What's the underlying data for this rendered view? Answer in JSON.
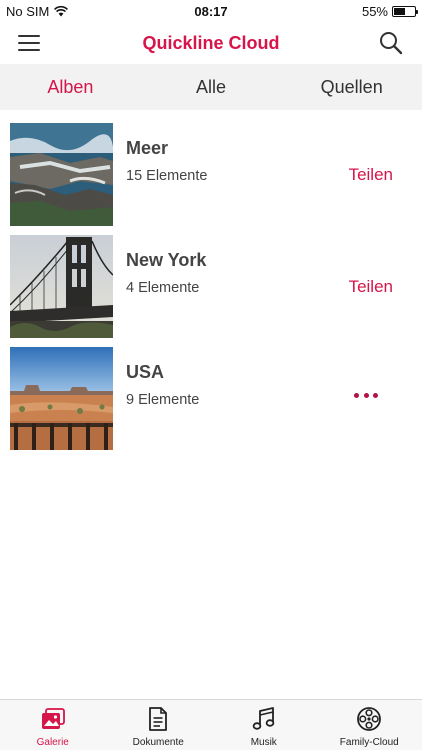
{
  "status_bar": {
    "carrier": "No SIM",
    "time": "08:17",
    "battery": "55%",
    "battery_level": 0.55
  },
  "header": {
    "title": "Quickline Cloud",
    "menu_icon": "menu-icon",
    "search_icon": "search-icon"
  },
  "tabs": [
    {
      "label": "Alben",
      "active": true
    },
    {
      "label": "Alle",
      "active": false
    },
    {
      "label": "Quellen",
      "active": false
    }
  ],
  "albums": [
    {
      "name": "Meer",
      "count": "15 Elemente",
      "action": "Teilen"
    },
    {
      "name": "New York",
      "count": "4 Elemente",
      "action": "Teilen"
    },
    {
      "name": "USA",
      "count": "9 Elemente",
      "action": "more-icon"
    }
  ],
  "tabbar": [
    {
      "label": "Galerie",
      "icon": "gallery-icon",
      "active": true
    },
    {
      "label": "Dokumente",
      "icon": "document-icon",
      "active": false
    },
    {
      "label": "Musik",
      "icon": "music-note-icon",
      "active": false
    },
    {
      "label": "Family-Cloud",
      "icon": "film-reel-icon",
      "active": false
    }
  ],
  "colors": {
    "accent": "#d6154a",
    "tab_background": "#f2f2f2"
  }
}
